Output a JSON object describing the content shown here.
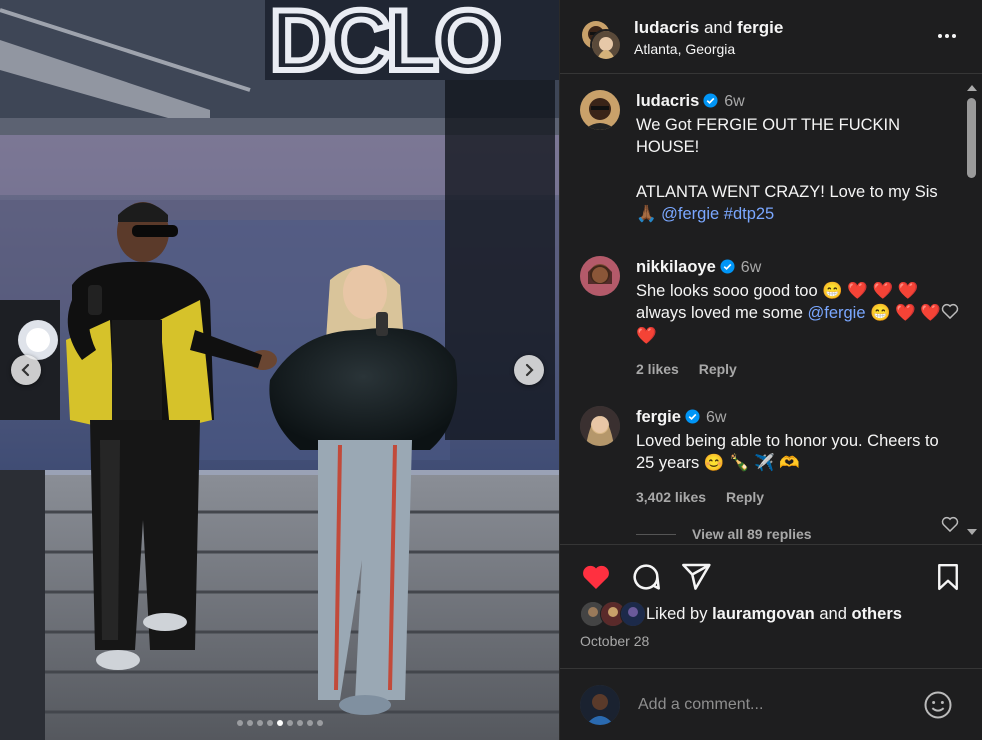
{
  "post": {
    "header": {
      "author1": "ludacris",
      "connector": "and",
      "author2": "fergie",
      "location": "Atlanta, Georgia"
    },
    "carousel": {
      "total_slides": 9,
      "current_slide": 5
    },
    "caption": {
      "user": "ludacris",
      "time": "6w",
      "line1": "We Got FERGIE OUT THE FUCKIN HOUSE!",
      "line2": "ATLANTA WENT CRAZY! Love to my Sis",
      "line3_prefix": "🙏🏾",
      "mention": "@fergie",
      "hashtag": "#dtp25"
    },
    "comments": [
      {
        "user": "nikkilaoye",
        "time": "6w",
        "text_a": "She looks sooo good too 😁 ❤️ ❤️ ❤️ always loved me some ",
        "mention": "@fergie",
        "text_b": " 😁 ❤️ ❤️ ❤️",
        "likes": "2 likes",
        "reply": "Reply"
      },
      {
        "user": "fergie",
        "time": "6w",
        "text": "Loved being able to honor you. Cheers to 25 years 😊 🍾 ✈️ 🫶",
        "likes": "3,402 likes",
        "reply": "Reply"
      }
    ],
    "view_replies": "View all 89 replies",
    "liked_by": {
      "prefix": "Liked by",
      "user": "lauramgovan",
      "connector": "and",
      "others": "others"
    },
    "date": "October 28",
    "comment_placeholder": "Add a comment...",
    "colors": {
      "like_red": "#ff3040",
      "link_blue": "#7aa7ff",
      "verified_blue": "#0095f6"
    },
    "icons": [
      "heart-icon",
      "comment-icon",
      "share-icon",
      "bookmark-icon",
      "emoji-icon",
      "more-icon",
      "verified-icon"
    ]
  }
}
